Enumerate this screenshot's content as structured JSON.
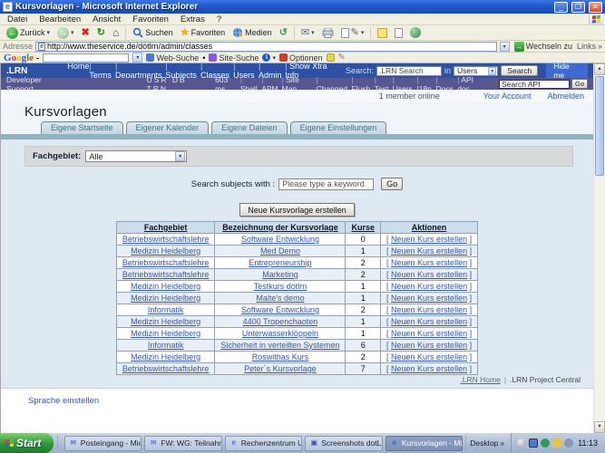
{
  "icons": {
    "back_arrow": "←",
    "forward_arrow": "→",
    "stop_x": "✖",
    "refresh": "↻",
    "home": "⌂",
    "star": "★",
    "history": "↺",
    "mail": "✉",
    "edit": "✎",
    "dropdown": "▾",
    "chevron": "»",
    "up_arrow": "▲",
    "down_arrow": "▼",
    "bullet": "•",
    "go_arrow": "→",
    "pencil": "✎",
    "info": "i",
    "ie_letter": "e",
    "search_glyph": "⌕"
  },
  "window": {
    "title": "Kursvorlagen - Microsoft Internet Explorer",
    "minimize": "_",
    "maximize": "❐",
    "close": "✕",
    "menu_items": [
      "Datei",
      "Bearbeiten",
      "Ansicht",
      "Favoriten",
      "Extras",
      "?"
    ],
    "toolbar_labels": {
      "back": "Zurück",
      "search": "Suchen",
      "favorites": "Favoriten",
      "media": "Medien"
    },
    "address": {
      "label": "Adresse",
      "url": "http://www.theservice.de/dotlrn/admin/classes",
      "go_label": "Wechseln zu",
      "links_label": "Links"
    },
    "google": {
      "logo_letters": [
        "G",
        "o",
        "o",
        "g",
        "l",
        "e"
      ],
      "logo_dash": "-",
      "web_search": "Web-Suche",
      "site_search": "Site-Suche",
      "options": "Optionen"
    }
  },
  "lrn_bar": {
    "logo": ".LRN",
    "links": [
      "Home",
      "Terms",
      "Departments",
      "Subjects",
      "Classes",
      "Users",
      "Admin",
      "Show Xtra Info"
    ],
    "separator": "|",
    "search_label": "Search:",
    "search_value": ".LRN Search",
    "in_label": "in",
    "scope_value": "Users",
    "search_button": "Search",
    "hide_me": "Hide me"
  },
  "dev_bar": {
    "left": "Developer Support",
    "mode": "USR DB TRN",
    "links": [
      "603 ms",
      "Shell",
      "APM",
      "Site Map",
      "Changed",
      "Flush",
      "Test",
      "Users",
      "I18n",
      "Docs",
      "API doc"
    ],
    "api_search_value": "Search API",
    "api_go": "Go"
  },
  "session": {
    "members_online": "1 member online",
    "your_account": "Your Account",
    "logout": "Abmelden"
  },
  "page": {
    "title": "Kursvorlagen",
    "tabs": [
      "Eigene Startseite",
      "Eigener Kalender",
      "Eigene Dateien",
      "Eigene Einstellungen"
    ],
    "filter_label": "Fachgebiet:",
    "filter_value": "Alle",
    "search_label": "Search subjects with :",
    "search_value": "Please type a keyword",
    "search_go": "Go",
    "new_template_button": "Neue Kursvorlage erstellen",
    "table": {
      "headers": [
        "Fachgebiet",
        "Bezeichnung der Kursvorlage",
        "Kurse",
        "Aktionen"
      ],
      "action_open": "[",
      "action_label": "Neuen Kurs erstellen",
      "action_close": "]",
      "rows": [
        {
          "fachgebiet": "Betriebswirtschaftslehre",
          "bezeichnung": "Software Entwicklung",
          "kurse": "0"
        },
        {
          "fachgebiet": "Medizin Heidelberg",
          "bezeichnung": "Med Demo",
          "kurse": "1"
        },
        {
          "fachgebiet": "Betriebswirtschaftslehre",
          "bezeichnung": "Entrepreneurship",
          "kurse": "2"
        },
        {
          "fachgebiet": "Betriebswirtschaftslehre",
          "bezeichnung": "Marketing",
          "kurse": "2"
        },
        {
          "fachgebiet": "Medizin Heidelberg",
          "bezeichnung": "Testkurs dotlrn",
          "kurse": "1"
        },
        {
          "fachgebiet": "Medizin Heidelberg",
          "bezeichnung": "Malte's demo",
          "kurse": "1"
        },
        {
          "fachgebiet": "Informatik",
          "bezeichnung": "Software Entwicklung",
          "kurse": "2"
        },
        {
          "fachgebiet": "Medizin Heidelberg",
          "bezeichnung": "4400 Tropenchaoten",
          "kurse": "1"
        },
        {
          "fachgebiet": "Medizin Heidelberg",
          "bezeichnung": "Unterwasserklöppeln",
          "kurse": "1"
        },
        {
          "fachgebiet": "Informatik",
          "bezeichnung": "Sicherheit in verteilten Systemen",
          "kurse": "6"
        },
        {
          "fachgebiet": "Medizin Heidelberg",
          "bezeichnung": "Roswithas Kurs",
          "kurse": "2"
        },
        {
          "fachgebiet": "Betriebswirtschaftslehre",
          "bezeichnung": "Peter´s Kursvorlage",
          "kurse": "7"
        }
      ]
    },
    "footer": {
      "home": ".LRN Home",
      "separator": "|",
      "central": ".LRN Project Central"
    },
    "language_link": "Sprache einstellen"
  },
  "taskbar": {
    "start": "Start",
    "tasks": [
      {
        "label": "Posteingang - Micros...",
        "glyph": "✉"
      },
      {
        "label": "FW: WG: Teilnahme v...",
        "glyph": "✉"
      },
      {
        "label": "Rechenzentrum Uni K...",
        "glyph": "e"
      },
      {
        "label": "Screenshots dotLR...",
        "glyph": "▣"
      },
      {
        "label": "Kursvorlagen - Micros...",
        "glyph": "e"
      }
    ],
    "desktop_label": "Desktop",
    "time": "11:13"
  }
}
